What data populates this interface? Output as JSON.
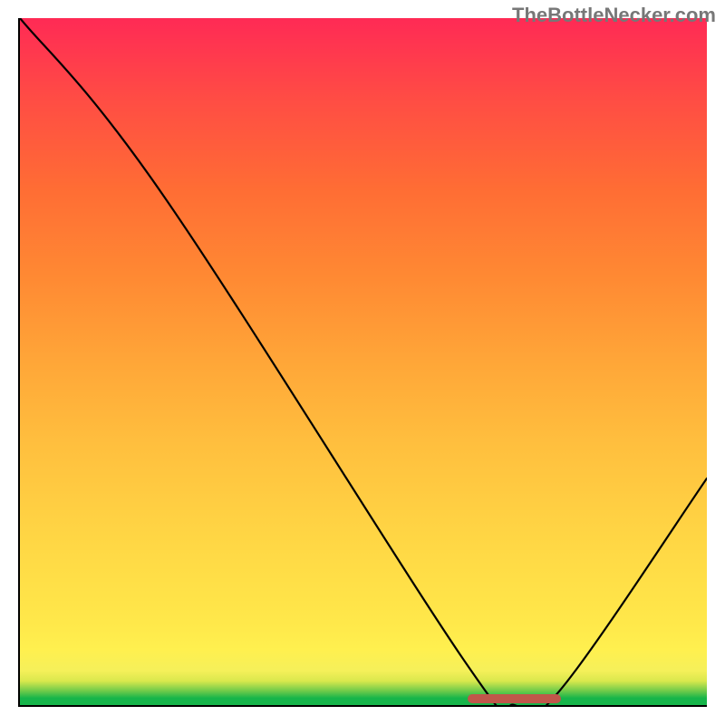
{
  "watermark": "TheBottleNecker.com",
  "colors": {
    "curve": "#000000",
    "marker": "#c0564a",
    "axis": "#000000"
  },
  "chart_data": {
    "type": "line",
    "title": "",
    "xlabel": "",
    "ylabel": "",
    "xlim": [
      0,
      100
    ],
    "ylim": [
      0,
      100
    ],
    "series": [
      {
        "name": "bottleneck-curve",
        "x": [
          0,
          21,
          65,
          72,
          78.5,
          100
        ],
        "values": [
          100,
          74,
          6,
          0,
          2,
          33
        ]
      }
    ],
    "annotations": [
      {
        "name": "optimal-range",
        "x_start": 65,
        "x_end": 78.5,
        "y": 0
      }
    ]
  }
}
